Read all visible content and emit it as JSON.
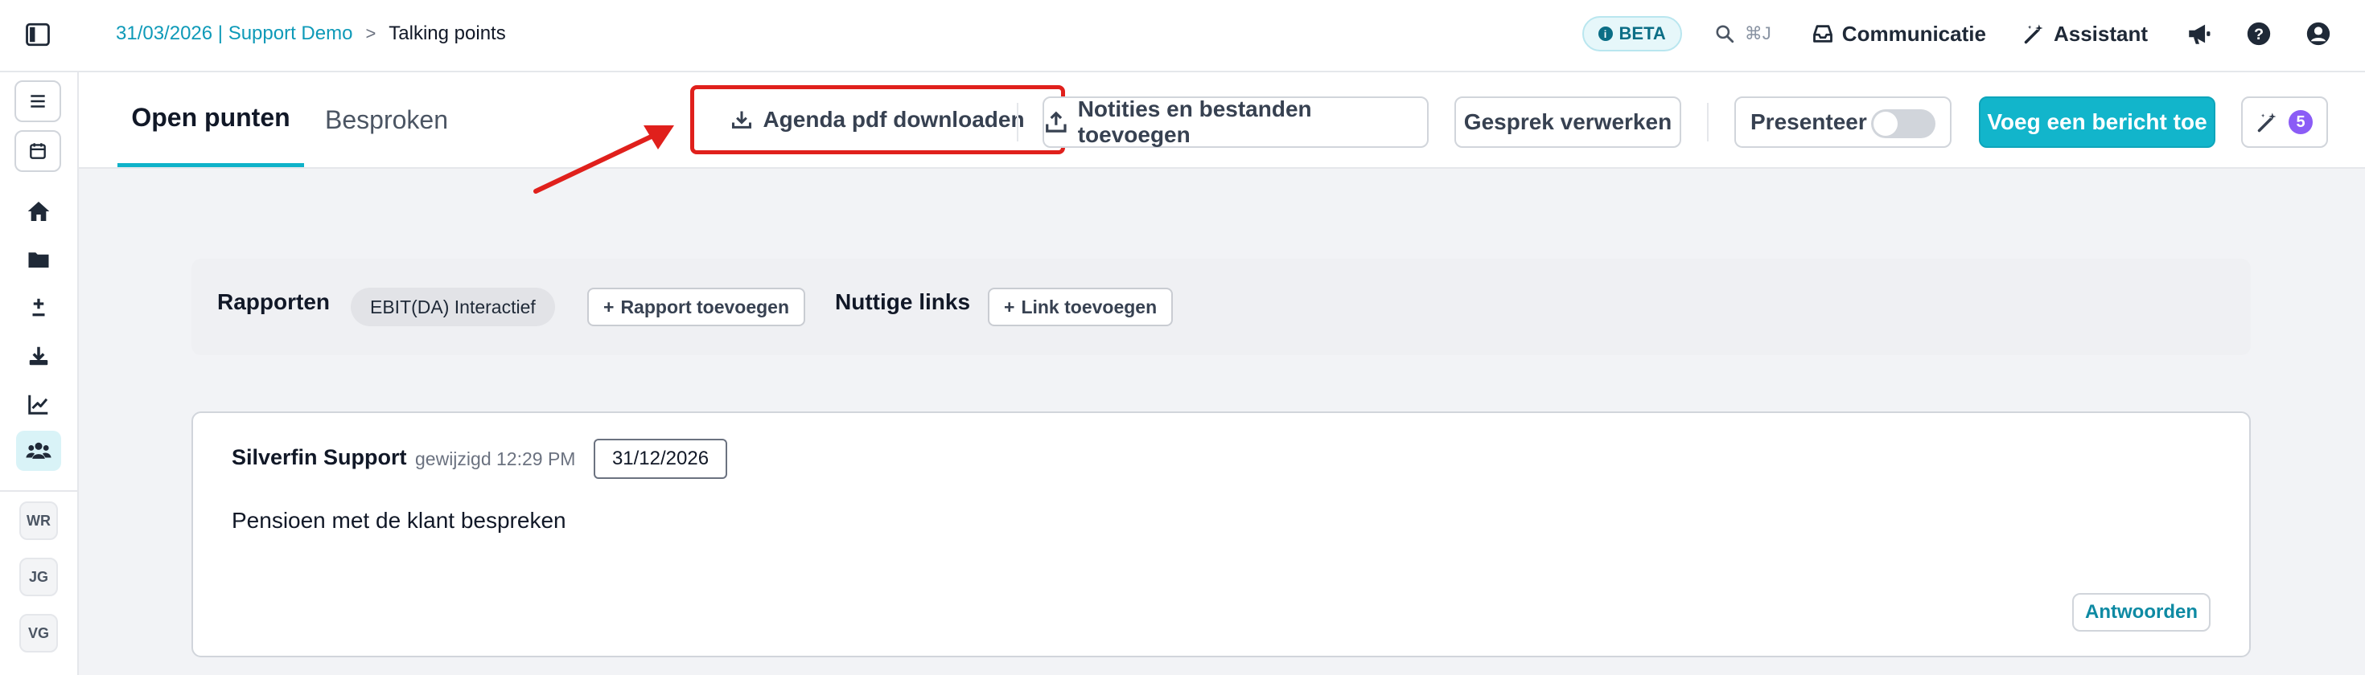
{
  "breadcrumb": {
    "parent": "31/03/2026 | Support Demo",
    "separator": ">",
    "current": "Talking points"
  },
  "topbar": {
    "beta_label": "BETA",
    "search_shortcut": "⌘J",
    "communication_label": "Communicatie",
    "assistant_label": "Assistant",
    "icons": [
      "sidebar-toggle-icon",
      "info-icon",
      "search-icon",
      "inbox-icon",
      "magic-wand-icon",
      "megaphone-icon",
      "help-icon",
      "user-icon"
    ]
  },
  "rail": {
    "icons": [
      "menu-icon",
      "calendar-icon",
      "home-icon",
      "folder-icon",
      "plus-minus-icon",
      "download-icon",
      "chart-line-icon",
      "users-icon"
    ],
    "active": "users-icon",
    "avatars": [
      "WR",
      "JG",
      "VG"
    ]
  },
  "tabs": {
    "open_label": "Open punten",
    "discussed_label": "Besproken",
    "active": "Open punten"
  },
  "actions": {
    "agenda_label": "Agenda pdf downloaden",
    "notes_label": "Notities en bestanden toevoegen",
    "process_label": "Gesprek verwerken",
    "present_label": "Presenteer",
    "present_toggle_on": false,
    "add_message_label": "Voeg een bericht toe",
    "assistant_count": "5"
  },
  "links_band": {
    "reports_label": "Rapporten",
    "report_chip": "EBIT(DA) Interactief",
    "add_report_label": "Rapport toevoegen",
    "useful_links_label": "Nuttige links",
    "add_link_label": "Link toevoegen"
  },
  "message": {
    "author": "Silverfin Support",
    "edited": "gewijzigd 12:29 PM",
    "date": "31/12/2026",
    "body": "Pensioen met de klant bespreken",
    "reply_label": "Antwoorden"
  },
  "colors": {
    "accent": "#12b5cb",
    "link": "#0e9ab8",
    "highlight": "#e0201c",
    "badge_purple": "#8b5cf6"
  }
}
